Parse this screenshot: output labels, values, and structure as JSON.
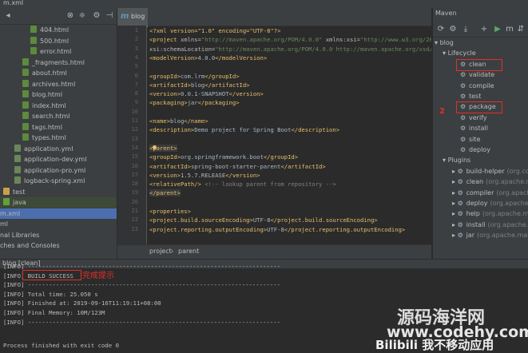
{
  "topbar": {
    "title": "m.xml"
  },
  "project": {
    "rows": [
      {
        "label": "404.html",
        "icon": "html",
        "indent": 38
      },
      {
        "label": "500.html",
        "icon": "html",
        "indent": 38
      },
      {
        "label": "error.html",
        "icon": "html",
        "indent": 38
      },
      {
        "label": "_fragments.html",
        "icon": "html",
        "indent": 28
      },
      {
        "label": "about.html",
        "icon": "html",
        "indent": 28
      },
      {
        "label": "archives.html",
        "icon": "html",
        "indent": 28
      },
      {
        "label": "blog.html",
        "icon": "html",
        "indent": 28
      },
      {
        "label": "index.html",
        "icon": "html",
        "indent": 28
      },
      {
        "label": "search.html",
        "icon": "html",
        "indent": 28
      },
      {
        "label": "tags.html",
        "icon": "html",
        "indent": 28
      },
      {
        "label": "types.html",
        "icon": "html",
        "indent": 28
      },
      {
        "label": "application.yml",
        "icon": "yml",
        "indent": 18
      },
      {
        "label": "application-dev.yml",
        "icon": "yml",
        "indent": 18
      },
      {
        "label": "application-pro.yml",
        "icon": "yml",
        "indent": 18
      },
      {
        "label": "logback-spring.xml",
        "icon": "yml",
        "indent": 18
      },
      {
        "label": "test",
        "icon": "folder",
        "indent": 4
      },
      {
        "label": "java",
        "icon": "gfolder",
        "indent": 4
      },
      {
        "label": "m.xml",
        "icon": "none",
        "indent": 0
      },
      {
        "label": "ml",
        "icon": "none",
        "indent": 0
      },
      {
        "label": "nal Libraries",
        "icon": "none",
        "indent": 0
      },
      {
        "label": "ches and Consoles",
        "icon": "none",
        "indent": 0
      }
    ]
  },
  "editor": {
    "tab_label": "blog",
    "tab_icon": "m",
    "lines": [
      {
        "n": "1",
        "parts": [
          [
            "pi",
            "<?xml version=\"1.0\" encoding=\"UTF-8\"?>"
          ]
        ]
      },
      {
        "n": "2",
        "parts": [
          [
            "tag",
            "<project "
          ],
          [
            "attr",
            "xmlns="
          ],
          [
            "str",
            "\"http://maven.apache.org/POM/4.0.0\""
          ],
          [
            "attr",
            " xmlns:xsi="
          ],
          [
            "str",
            "\"http://www.w3.org/2001/XMLS"
          ]
        ]
      },
      {
        "n": "3",
        "parts": [
          [
            "attr",
            "         xsi:schemaLocation="
          ],
          [
            "str",
            "\"http://maven.apache.org/POM/4.0.0 http://maven.apache.org/xsd/maven"
          ]
        ]
      },
      {
        "n": "4",
        "parts": [
          [
            "tag",
            "    <modelVersion>"
          ],
          [
            "txt",
            "4.0.0"
          ],
          [
            "tag",
            "</modelVersion>"
          ]
        ]
      },
      {
        "n": "5",
        "parts": []
      },
      {
        "n": "6",
        "parts": [
          [
            "tag",
            "    <groupId>"
          ],
          [
            "txt",
            "com.lrm"
          ],
          [
            "tag",
            "</groupId>"
          ]
        ]
      },
      {
        "n": "7",
        "parts": [
          [
            "tag",
            "    <artifactId>"
          ],
          [
            "txt",
            "blog"
          ],
          [
            "tag",
            "</artifactId>"
          ]
        ]
      },
      {
        "n": "8",
        "parts": [
          [
            "tag",
            "    <version>"
          ],
          [
            "txt",
            "0.0.1-SNAPSHOT"
          ],
          [
            "tag",
            "</version>"
          ]
        ]
      },
      {
        "n": "9",
        "parts": [
          [
            "tag",
            "    <packaging>"
          ],
          [
            "txt",
            "jar"
          ],
          [
            "tag",
            "</packaging>"
          ]
        ]
      },
      {
        "n": "10",
        "parts": []
      },
      {
        "n": "11",
        "parts": [
          [
            "tag",
            "    <name>"
          ],
          [
            "txt",
            "blog"
          ],
          [
            "tag",
            "</name>"
          ]
        ]
      },
      {
        "n": "12",
        "parts": [
          [
            "tag",
            "    <description>"
          ],
          [
            "txt",
            "Demo project for Spring Boot"
          ],
          [
            "tag",
            "</description>"
          ]
        ]
      },
      {
        "n": "13",
        "parts": []
      },
      {
        "n": "14",
        "parts": [
          [
            "tag",
            "    <parent>"
          ]
        ]
      },
      {
        "n": "15",
        "parts": [
          [
            "tag",
            "        <groupId>"
          ],
          [
            "txt",
            "org.springframework.boot"
          ],
          [
            "tag",
            "</groupId>"
          ]
        ]
      },
      {
        "n": "16",
        "parts": [
          [
            "tag",
            "        <artifactId>"
          ],
          [
            "txt",
            "spring-boot-starter-parent"
          ],
          [
            "tag",
            "</artifactId>"
          ]
        ]
      },
      {
        "n": "17",
        "parts": [
          [
            "tag",
            "        <version>"
          ],
          [
            "txt",
            "1.5.7.RELEASE"
          ],
          [
            "tag",
            "</version>"
          ]
        ]
      },
      {
        "n": "18",
        "parts": [
          [
            "tag",
            "        <relativePath/>"
          ],
          [
            "cm",
            " <!-- lookup parent from repository -->"
          ]
        ]
      },
      {
        "n": "19",
        "parts": [
          [
            "tag",
            "    </parent>"
          ]
        ]
      },
      {
        "n": "20",
        "parts": []
      },
      {
        "n": "21",
        "parts": [
          [
            "tag",
            "    <properties>"
          ]
        ]
      },
      {
        "n": "22",
        "parts": [
          [
            "tag",
            "        <project.build.sourceEncoding>"
          ],
          [
            "txt",
            "UTF-8"
          ],
          [
            "tag",
            "</project.build.sourceEncoding>"
          ]
        ]
      },
      {
        "n": "23",
        "parts": [
          [
            "tag",
            "        <project.reporting.outputEncoding>"
          ],
          [
            "txt",
            "UTF-8"
          ],
          [
            "tag",
            "</project.reporting.outputEncoding>"
          ]
        ]
      }
    ],
    "breadcrumb": [
      "project",
      "parent"
    ]
  },
  "maven": {
    "title": "Maven",
    "root": "blog",
    "lifecycle_label": "Lifecycle",
    "lifecycle": [
      "clean",
      "validate",
      "compile",
      "test",
      "package",
      "verify",
      "install",
      "site",
      "deploy"
    ],
    "plugins_label": "Plugins",
    "plugins": [
      {
        "name": "build-helper",
        "group": "(org.codeh"
      },
      {
        "name": "clean",
        "group": "(org.apache.mave"
      },
      {
        "name": "compiler",
        "group": "(org.apache.ma"
      },
      {
        "name": "deploy",
        "group": "(org.apache.mave"
      },
      {
        "name": "help",
        "group": "(org.apache.maven"
      },
      {
        "name": "install",
        "group": "(org.apache.mave"
      },
      {
        "name": "jar",
        "group": "(org.apache.maven"
      }
    ],
    "annotation_number": "2"
  },
  "run": {
    "tab_label": "blog [clean]",
    "lines": [
      "[INFO] ------------------------------------------------------------------------",
      "[INFO] BUILD SUCCESS",
      "[INFO] ------------------------------------------------------------------------",
      "[INFO] Total time: 25.050 s",
      "[INFO] Finished at: 2019-09-16T11:19:11+08:00",
      "[INFO] Final Memory: 10M/123M",
      "[INFO] ------------------------------------------------------------------------",
      "",
      "Process finished with exit code 0"
    ],
    "done_hint": "完成提示"
  },
  "watermark": {
    "line1": "源码海洋网",
    "line2": "www.codehy.com",
    "line3": "Bilibili 我不移动应用"
  },
  "colors": {
    "accent_red": "#e0302a",
    "selection": "#4b6eaf"
  }
}
